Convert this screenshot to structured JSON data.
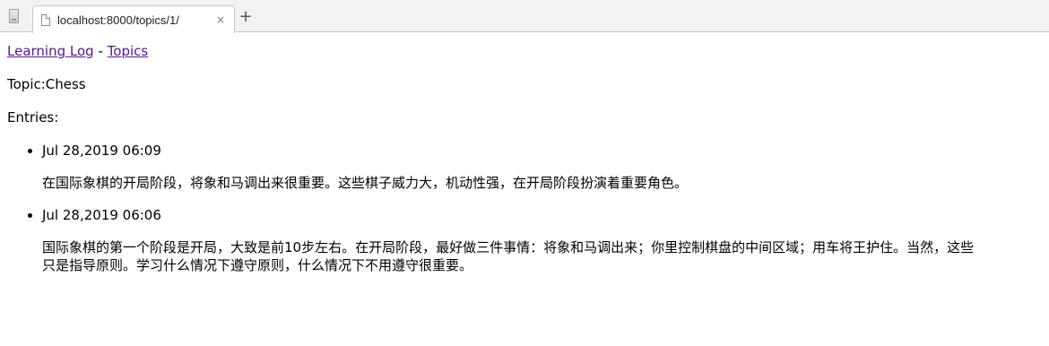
{
  "browser": {
    "tab_title": "localhost:8000/topics/1/",
    "close_glyph": "×",
    "new_tab_glyph": "+",
    "side_icon": "tablet-icon",
    "favicon": "page-icon"
  },
  "page": {
    "nav": {
      "home_link": "Learning Log",
      "separator": "-",
      "topics_link": "Topics",
      "link_color": "#551a8b"
    },
    "topic_line": "Topic:Chess",
    "entries_label": "Entries:",
    "entries": [
      {
        "date": "Jul 28,2019 06:09",
        "text": "在国际象棋的开局阶段，将象和马调出来很重要。这些棋子威力大，机动性强，在开局阶段扮演着重要角色。"
      },
      {
        "date": "Jul 28,2019 06:06",
        "text": "国际象棋的第一个阶段是开局，大致是前10步左右。在开局阶段，最好做三件事情：将象和马调出来；你里控制棋盘的中间区域；用车将王护住。当然，这些只是指导原则。学习什么情况下遵守原则，什么情况下不用遵守很重要。"
      }
    ]
  }
}
